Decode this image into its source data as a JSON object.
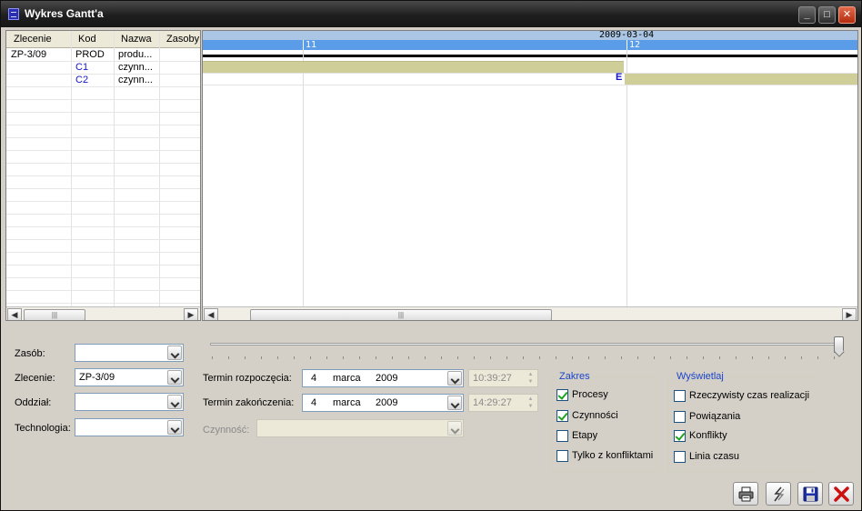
{
  "window": {
    "title": "Wykres Gantt'a"
  },
  "grid": {
    "columns": [
      "Zlecenie",
      "Kod",
      "Nazwa",
      "Zasoby"
    ],
    "rows": [
      {
        "zlecenie": "ZP-3/09",
        "kod": "PROD",
        "nazwa": "produ..."
      },
      {
        "zlecenie": "",
        "kod": "C1",
        "nazwa": "czynn..."
      },
      {
        "zlecenie": "",
        "kod": "C2",
        "nazwa": "czynn..."
      }
    ]
  },
  "gantt": {
    "date": "2009-03-04",
    "hours": [
      "11",
      "12"
    ],
    "marker": "E"
  },
  "form": {
    "zasob_label": "Zasób:",
    "zasob_value": "",
    "zlecenie_label": "Zlecenie:",
    "zlecenie_value": "ZP-3/09",
    "oddzial_label": "Oddział:",
    "oddzial_value": "",
    "technologia_label": "Technologia:",
    "technologia_value": "",
    "start_label": "Termin rozpoczęcia:",
    "start_day": "4",
    "start_month": "marca",
    "start_year": "2009",
    "start_time": "10:39:27",
    "end_label": "Termin zakończenia:",
    "end_day": "4",
    "end_month": "marca",
    "end_year": "2009",
    "end_time": "14:29:27",
    "czynnosc_label": "Czynność:",
    "czynnosc_value": ""
  },
  "zakres": {
    "title": "Zakres",
    "items": [
      {
        "label": "Procesy",
        "checked": true
      },
      {
        "label": "Czynności",
        "checked": true
      },
      {
        "label": "Etapy",
        "checked": false
      },
      {
        "label": "Tylko z konfliktami",
        "checked": false
      }
    ]
  },
  "wyswietlaj": {
    "title": "Wyświetlaj",
    "items": [
      {
        "label": "Rzeczywisty czas realizacji",
        "checked": false
      },
      {
        "label": "Powiązania",
        "checked": false
      },
      {
        "label": "Konflikty",
        "checked": true
      },
      {
        "label": "Linia czasu",
        "checked": false
      }
    ]
  },
  "slider": {
    "value_fraction": 1.0
  },
  "icons": {
    "print": "printer-icon",
    "refresh": "lightning-icon",
    "save": "floppy-icon",
    "close": "close-x-icon"
  },
  "colors": {
    "bar": "#cfcd98",
    "header_blue": "#5a9ce8",
    "header_light": "#aac6e4",
    "group_title": "#1b45c8",
    "close_x": "#cc1111"
  }
}
